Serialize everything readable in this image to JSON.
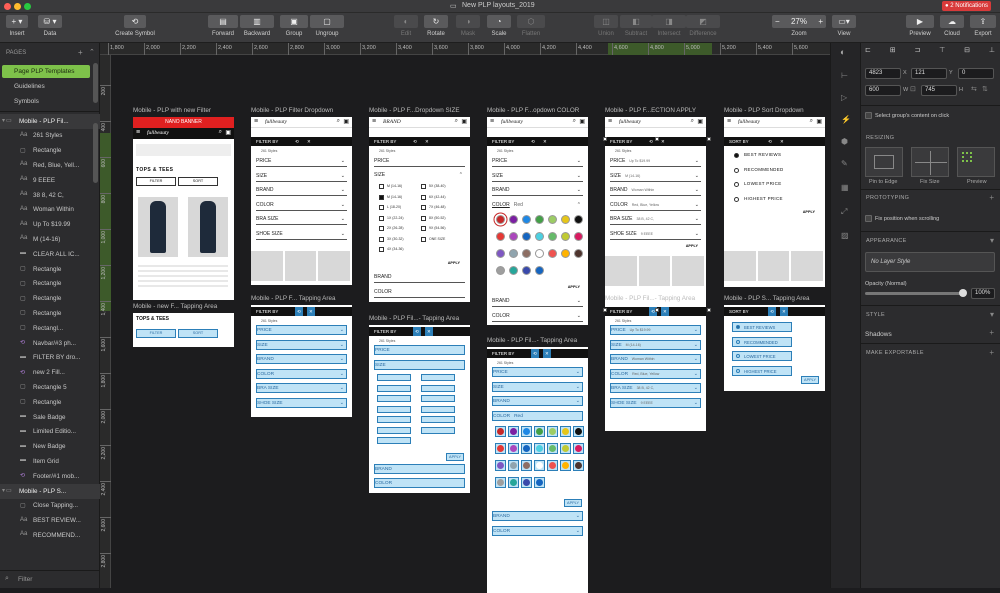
{
  "window": {
    "title": "New PLP layouts_2019",
    "notifications": "2 Notifications"
  },
  "toolbar": {
    "insert": "Insert",
    "data": "Data",
    "create_symbol": "Create Symbol",
    "forward": "Forward",
    "backward": "Backward",
    "group": "Group",
    "ungroup": "Ungroup",
    "edit": "Edit",
    "rotate": "Rotate",
    "mask": "Mask",
    "scale": "Scale",
    "flatten": "Flatten",
    "union": "Union",
    "subtract": "Subtract",
    "intersect": "Intersect",
    "difference": "Difference",
    "zoom_label": "Zoom",
    "zoom_value": "27%",
    "view": "View",
    "preview": "Preview",
    "cloud": "Cloud",
    "export": "Export"
  },
  "sidebar": {
    "pages_header": "PAGES",
    "pages": [
      "Page PLP Templates",
      "Guidelines",
      "Symbols"
    ],
    "layers": [
      {
        "label": "Mobile  - PLP Fil...",
        "type": "artboard",
        "indent": 0
      },
      {
        "label": "261 Styles",
        "type": "text",
        "indent": 1
      },
      {
        "label": "Rectangle",
        "type": "shape",
        "indent": 1
      },
      {
        "label": "Red, Blue, Yell...",
        "type": "text",
        "indent": 1
      },
      {
        "label": "9 EEEE",
        "type": "text",
        "indent": 1
      },
      {
        "label": "38 8, 42 C,",
        "type": "text",
        "indent": 1
      },
      {
        "label": "Woman Within",
        "type": "text",
        "indent": 1
      },
      {
        "label": "Up To $19.99",
        "type": "text",
        "indent": 1
      },
      {
        "label": "M (14-16)",
        "type": "text",
        "indent": 1
      },
      {
        "label": "CLEAR ALL IC...",
        "type": "group",
        "indent": 1
      },
      {
        "label": "Rectangle",
        "type": "shape",
        "indent": 1
      },
      {
        "label": "Rectangle",
        "type": "shape",
        "indent": 1
      },
      {
        "label": "Rectangle",
        "type": "shape",
        "indent": 1
      },
      {
        "label": "Rectangle",
        "type": "shape",
        "indent": 1
      },
      {
        "label": "Rectangl...",
        "type": "shape",
        "indent": 1
      },
      {
        "label": "Navbar/#3 ph...",
        "type": "symbol",
        "indent": 1
      },
      {
        "label": "FILTER BY dro...",
        "type": "group",
        "indent": 1
      },
      {
        "label": "new 2 Fill...",
        "type": "symbol",
        "indent": 1
      },
      {
        "label": "Rectangle 5",
        "type": "shape",
        "indent": 1
      },
      {
        "label": "Rectangle",
        "type": "shape",
        "indent": 1
      },
      {
        "label": "Sale Badge",
        "type": "group",
        "indent": 1
      },
      {
        "label": "Limited Editio...",
        "type": "group",
        "indent": 1
      },
      {
        "label": "New Badge",
        "type": "group",
        "indent": 1
      },
      {
        "label": "Item Grid",
        "type": "group",
        "indent": 1
      },
      {
        "label": "Footer/#1 mob...",
        "type": "symbol",
        "indent": 1
      },
      {
        "label": "Mobile  - PLP S...",
        "type": "artboard",
        "indent": 0
      },
      {
        "label": "Close Tapping...",
        "type": "shape",
        "indent": 1
      },
      {
        "label": "BEST REVIEW...",
        "type": "text",
        "indent": 1
      },
      {
        "label": "RECOMMEND...",
        "type": "text",
        "indent": 1
      }
    ],
    "filter_label": "Filter"
  },
  "ruler": {
    "top": [
      "1,800",
      "2,000",
      "2,200",
      "2,400",
      "2,600",
      "2,800",
      "3,000",
      "3,200",
      "3,400",
      "3,600",
      "3,800",
      "4,000",
      "4,200",
      "4,400",
      "4,600",
      "4,800",
      "5,000",
      "5,200",
      "5,400",
      "5,600"
    ],
    "left": [
      "200",
      "400",
      "600",
      "800",
      "1,000",
      "1,200",
      "1,400",
      "1,600",
      "1,800",
      "2,000",
      "2,200",
      "2,400",
      "2,600",
      "2,800"
    ]
  },
  "artboards": {
    "a1": {
      "title": "Mobile  - PLP with new Filter",
      "banner": "NANO BANNER",
      "brand": "fullbeauty",
      "heading": "TOPS & TEES",
      "filter": "FILTER",
      "sort": "SORT"
    },
    "a1b": {
      "title": "Mobile  - new F... Tapping Area",
      "heading": "TOPS & TEES",
      "filter": "FILTER",
      "sort": "SORT"
    },
    "a2": {
      "title": "Mobile  - PLP Filter Dropdown",
      "brand": "fullbeauty",
      "filter_by": "FILTER BY",
      "count": "261 Styles",
      "rows": [
        "PRICE",
        "SIZE",
        "BRAND",
        "COLOR",
        "BRA SIZE",
        "SHOE SIZE"
      ]
    },
    "a2b": {
      "title": "Mobile  - PLP F... Tapping Area",
      "filter_by": "FILTER BY",
      "count": "261 Styles",
      "rows": [
        "PRICE",
        "SIZE",
        "BRAND",
        "COLOR",
        "BRA SIZE",
        "SHOE SIZE"
      ]
    },
    "a3": {
      "title": "Mobile  - PLP F...Dropdown SIZE",
      "brand": "BRAND",
      "filter_by": "FILTER BY",
      "count": "261 Styles",
      "price": "PRICE",
      "size": "SIZE",
      "sizes_left": [
        "M (14-16)",
        "M (14-16)",
        "L (18-20)",
        "1X (22-24)",
        "2X (26-28)",
        "3X (30-32)",
        "4X (34-36)"
      ],
      "sizes_right": [
        "5X (38-40)",
        "6X (42-44)",
        "7X (46-48)",
        "8X (50-52)",
        "9X (54-56)",
        "ONE SIZE"
      ],
      "apply": "APPLY",
      "color": "COLOR"
    },
    "a3b": {
      "title": "Mobile  - PLP Fil...- Tapping Area",
      "filter_by": "FILTER BY",
      "count": "261 Styles",
      "price": "PRICE",
      "size": "SIZE",
      "apply": "APPLY",
      "brand": "BRAND",
      "color": "COLOR"
    },
    "a4": {
      "title": "Mobile  - PLP F...opdown COLOR",
      "brand": "fullbeauty",
      "filter_by": "FILTER BY",
      "count": "261 Styles",
      "rows": [
        "PRICE",
        "SIZE",
        "BRAND"
      ],
      "color_label": "COLOR",
      "color_sel": "Red",
      "apply": "APPLY",
      "rows2": [
        "BRAND",
        "COLOR"
      ],
      "swatches": [
        "#c62828",
        "#7b1fa2",
        "#1e88e5",
        "#43a047",
        "#9ccc65",
        "#e6c619",
        "#111111",
        "#e53935",
        "#ab47bc",
        "#1565c0",
        "#4dd0e1",
        "#66bb6a",
        "#c0ca33",
        "#d81b60",
        "#7e57c2",
        "#90a4ae",
        "#8d6e63",
        "#ffffff",
        "#ef5350",
        "#ffb300",
        "#4e342e",
        "#9e9e9e",
        "#26a69a",
        "#3949ab",
        "#1565c0"
      ]
    },
    "a4b": {
      "title": "Mobile  - PLP Fil...- Tapping Area",
      "filter_by": "FILTER BY",
      "count": "261 Styles",
      "rows": [
        "PRICE",
        "SIZE",
        "BRAND"
      ],
      "color_label": "COLOR",
      "color_sel": "Red",
      "apply": "APPLY",
      "rows2": [
        "BRAND",
        "COLOR"
      ]
    },
    "a5": {
      "title": "Mobile  - PLP F...ECTION APPLY",
      "brand": "fullbeauty",
      "filter_by": "FILTER BY",
      "count": "261 Styles",
      "rows": [
        {
          "k": "PRICE",
          "v": "Up To $19.99"
        },
        {
          "k": "SIZE",
          "v": "M (14-16)"
        },
        {
          "k": "BRAND",
          "v": "Woman Within"
        },
        {
          "k": "COLOR",
          "v": "Red, Blue, Yellow"
        },
        {
          "k": "BRA SIZE",
          "v": "38 B, 42 C,"
        },
        {
          "k": "SHOE SIZE",
          "v": "9 EEEE"
        }
      ],
      "apply": "APPLY"
    },
    "a5b": {
      "title": "Mobile  - PLP Fil...- Tapping Area",
      "filter_by": "FILTER BY",
      "count": "261 Styles",
      "rows": [
        {
          "k": "PRICE",
          "v": "Up To $19.99"
        },
        {
          "k": "SIZE",
          "v": "M (14-16)"
        },
        {
          "k": "BRAND",
          "v": "Woman Within"
        },
        {
          "k": "COLOR",
          "v": "Red, Blue, Yellow"
        },
        {
          "k": "BRA SIZE",
          "v": "38 B, 42 C,"
        },
        {
          "k": "SHOE SIZE",
          "v": "9 EEEE"
        }
      ]
    },
    "a6": {
      "title": "Mobile  - PLP Sort Dropdown",
      "brand": "fullbeauty",
      "sort_by": "SORT BY",
      "options": [
        "BEST REVIEWS",
        "RECOMMENDED",
        "LOWEST PRICE",
        "HIGHEST PRICE"
      ],
      "apply": "APPLY"
    },
    "a6b": {
      "title": "Mobile  - PLP S... Tapping Area",
      "sort_by": "SORT BY",
      "options": [
        "BEST REVIEWS",
        "RECOMMENDED",
        "LOWEST PRICE",
        "HIGHEST PRICE"
      ],
      "apply": "APPLY"
    }
  },
  "inspector": {
    "x": "4823",
    "x_l": "X",
    "y": "121",
    "y_l": "Y",
    "rot": "0",
    "w": "600",
    "w_l": "W",
    "h": "745",
    "h_l": "H",
    "select_group": "Select group's content on click",
    "resizing": "RESIZING",
    "pin": "Pin to Edge",
    "fix": "Fix Size",
    "preview": "Preview",
    "prototyping": "PROTOTYPING",
    "fix_pos": "Fix position when scrolling",
    "appearance": "APPEARANCE",
    "layer_style": "No Layer Style",
    "opacity_label": "Opacity (Normal)",
    "opacity": "100%",
    "opacity_level": 1.0,
    "style": "STYLE",
    "shadows": "Shadows",
    "exportable": "MAKE EXPORTABLE"
  },
  "colors": {
    "accent": "#7ec24a",
    "canvas": "#1c1c1e",
    "tap": "#bfe3f6",
    "tap_border": "#2c7fb8",
    "banner": "#e02020",
    "notif": "#d83a3a"
  }
}
